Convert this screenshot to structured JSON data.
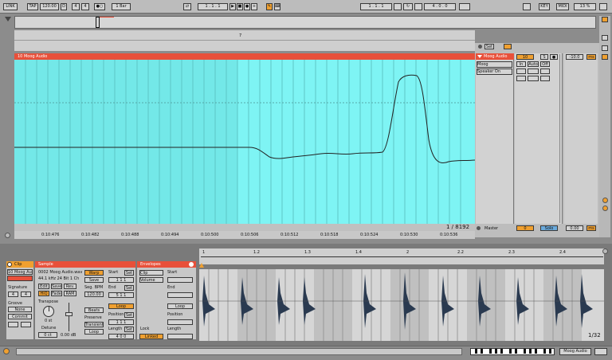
{
  "transport": {
    "link": "LINK",
    "tap": "TAP",
    "tempo": "120.00",
    "meter_num": "4",
    "meter_den": "4",
    "metro": "●○",
    "quantize": "1 Bar",
    "position": "1 . 1 . 1",
    "loop_start": "1 . 1 . 1",
    "loop_length": "4 . 0 . 0",
    "key": "KEY",
    "midi": "MIDI",
    "cpu": "13 %",
    "d_label": "D"
  },
  "arrangement": {
    "ruler_marker": "7",
    "track_name": "10 Moog Audio",
    "zoom_readout": "1 / 8192",
    "time_labels": [
      "0:10:476",
      "0:10:482",
      "0:10:488",
      "0:10:494",
      "0:10:500",
      "0:10:506",
      "0:10:512",
      "0:10:518",
      "0:10:524",
      "0:10:530",
      "0:10:536"
    ]
  },
  "mixer": {
    "set_label": "Set",
    "track_title": "Moog Audio",
    "input_type": "Moog",
    "input_channel": "Speaker On",
    "track_number": "10",
    "solo": "S",
    "in_label": "In",
    "auto_label": "Auto",
    "off_label": "Off",
    "volume": "-10.0",
    "sends": "1",
    "ms": "ms",
    "master_label": "Master",
    "master_number": "0",
    "master_solo": "Solo",
    "master_volume": "0.00"
  },
  "clip_panel": {
    "title": "Clip",
    "clip_name": "10 Moog Audio",
    "sig_label": "Signature",
    "sig_num": "4",
    "sig_den": "4",
    "groove_label": "Groove",
    "groove_value": "None",
    "commit": "Commit"
  },
  "sample_panel": {
    "title": "Sample",
    "file": "0002 Moog Audio.wav",
    "info": "44.1 kHz 24 Bit 1 Ch",
    "edit": "Edit",
    "save": "Save",
    "rev": "Rev.",
    "hiq": "HiQ",
    "fade": "Fade",
    "ram": "RAM",
    "transpose_label": "Transpose",
    "transpose_value": "0 st",
    "detune_label": "Detune",
    "detune_value": "0 ct",
    "gain_value": "0.00 dB",
    "warp": "Warp",
    "seg_label": "Seg. BPM",
    "seg_bpm": "120.00",
    "beats": "Beats",
    "preserve": "Preserve",
    "transients": "Transients",
    "loop_mode": "Loop",
    "start_label": "Start",
    "start_value": "1  1  1",
    "end_label": "End",
    "end_value": "5  1  1",
    "loop_btn": "Loop",
    "position_label": "Position",
    "position_value": "1  1  1",
    "length_label": "Length",
    "length_value": "4  0  0",
    "set": "Set"
  },
  "envelope_panel": {
    "title": "Envelopes",
    "device": "Clip",
    "control": "Volume",
    "start_label": "Start",
    "end_label": "End",
    "loop_btn": "Loop",
    "position_label": "Position",
    "length_label": "Length",
    "linked": "Linked",
    "lock": "Lock"
  },
  "clip_view": {
    "ruler_labels": [
      "1",
      "1.2",
      "1.3",
      "1.4",
      "2",
      "2.2",
      "2.3",
      "2.4"
    ],
    "zoom_readout": "1/32"
  },
  "statusbar": {
    "track_selector": "Moog Audio"
  },
  "colors": {
    "automation_bg": "#7ef4f4",
    "track_header": "#e8503a",
    "accent": "#f0a030",
    "panel": "#c8c8c8"
  }
}
